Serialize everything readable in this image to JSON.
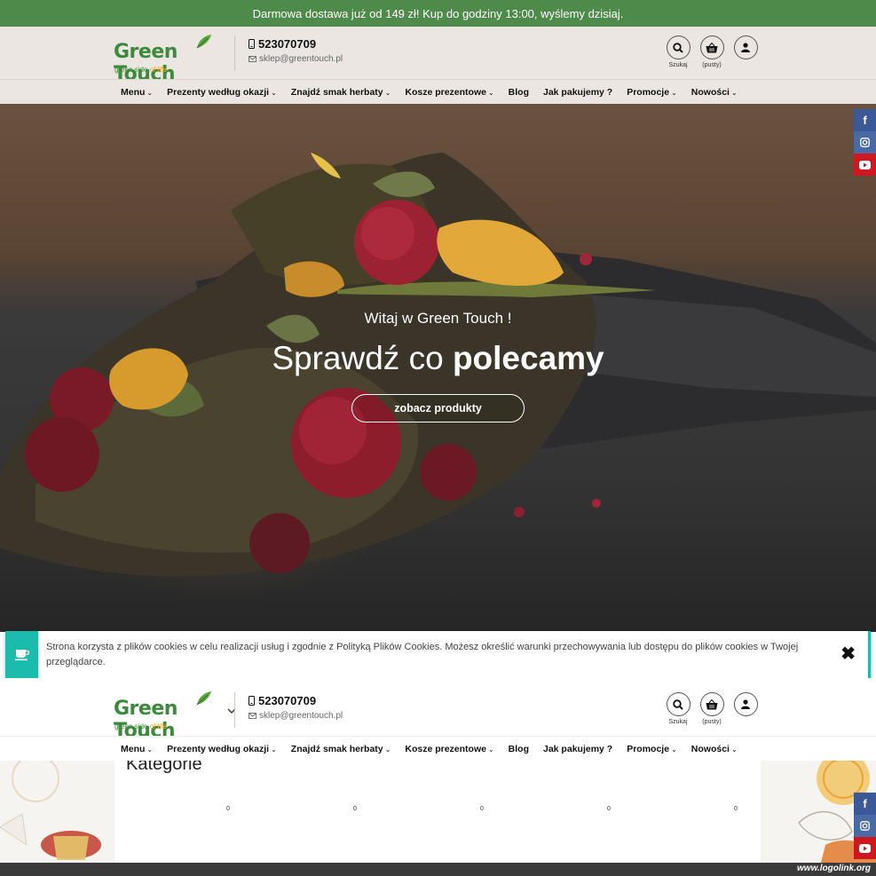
{
  "topbar": {
    "text": "Darmowa dostawa już od 149 zł! Kup do godziny 13:00, wyślemy dzisiaj."
  },
  "header": {
    "logo_name": "Green Touch",
    "logo_tag_main": "green side ",
    "logo_tag_accent": "of life",
    "phone": "523070709",
    "email": "sklep@greentouch.pl",
    "search_label": "Szukaj",
    "cart_label": "(pusty)"
  },
  "nav": [
    {
      "label": "Menu",
      "dropdown": true
    },
    {
      "label": "Prezenty według okazji",
      "dropdown": true
    },
    {
      "label": "Znajdź smak herbaty",
      "dropdown": true
    },
    {
      "label": "Kosze prezentowe",
      "dropdown": true
    },
    {
      "label": "Blog",
      "dropdown": false
    },
    {
      "label": "Jak pakujemy ?",
      "dropdown": false
    },
    {
      "label": "Promocje",
      "dropdown": true
    },
    {
      "label": "Nowości",
      "dropdown": true
    }
  ],
  "hero": {
    "welcome": "Witaj w Green Touch !",
    "headline_light": "Sprawdź co ",
    "headline_bold": "polecamy",
    "cta": "zobacz produkty"
  },
  "cookie": {
    "text": "Strona korzysta z plików cookies w celu realizacji usług i zgodnie z Polityką Plików Cookies. Możesz określić warunki przechowywania lub dostępu do plików cookies w Twojej przeglądarce.",
    "close": "✖"
  },
  "categories": {
    "title": "Kategorie",
    "counts": [
      "0",
      "0",
      "0",
      "0",
      "0"
    ]
  },
  "social": [
    "facebook",
    "instagram",
    "youtube"
  ],
  "watermark": "www.logolink.org",
  "colors": {
    "topbar": "#4e8a4a",
    "brand_green": "#3e8a3d",
    "cookie_accent": "#1bbcad",
    "facebook": "#3b5998",
    "instagram": "#4a6aa5",
    "youtube": "#cc181e"
  }
}
